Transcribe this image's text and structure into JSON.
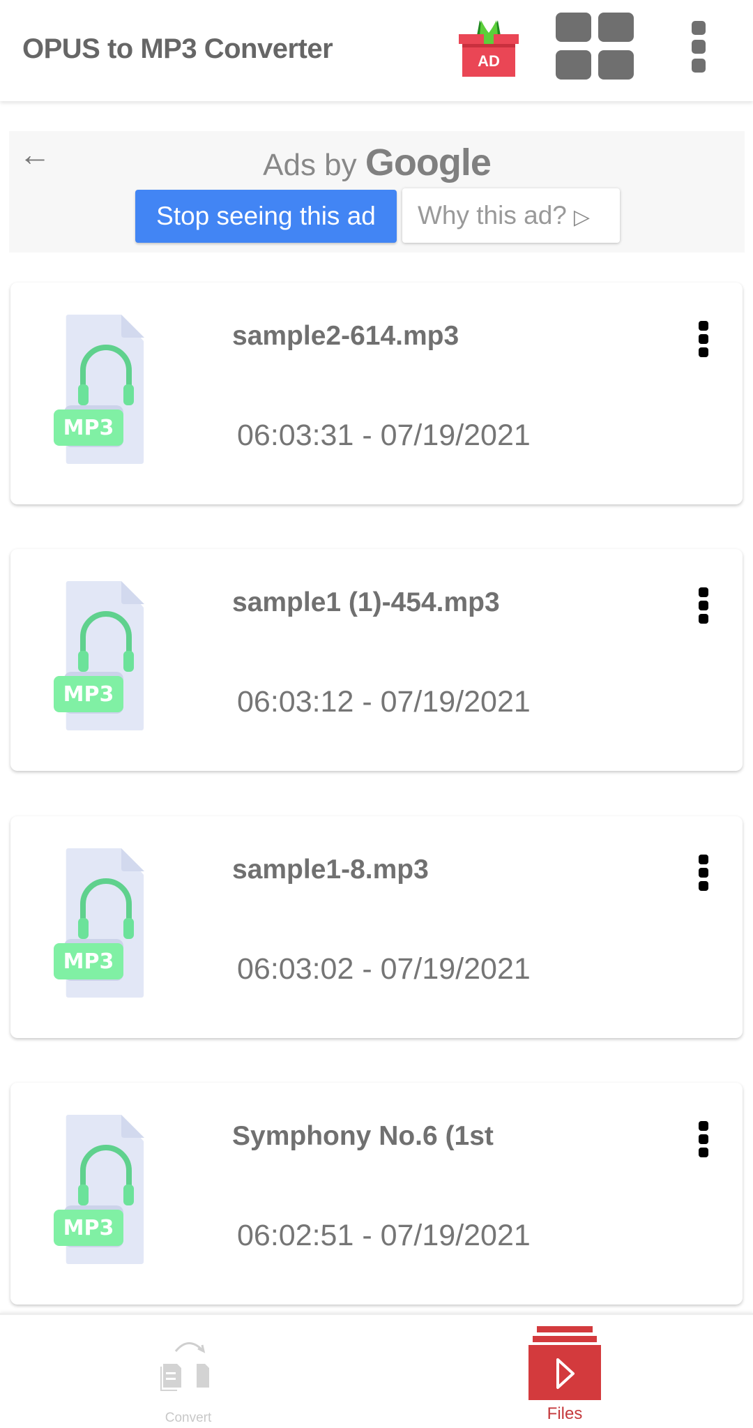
{
  "app_bar": {
    "title": "OPUS to MP3 Converter",
    "gift_badge": "AD",
    "icons": [
      "gift-ad-icon",
      "grid-view-icon",
      "more-vert-icon"
    ]
  },
  "ad": {
    "prefix": "Ads by ",
    "brand": "Google",
    "stop_label": "Stop seeing this ad",
    "why_label": "Why this ad?",
    "back_icon": "arrow-left-icon",
    "why_icon": "adchoices-icon",
    "accent": "#4285f4"
  },
  "files": [
    {
      "name": "sample2-614.mp3",
      "datetime": "06:03:31 - 07/19/2021",
      "badge": "MP3"
    },
    {
      "name": "sample1 (1)-454.mp3",
      "datetime": "06:03:12 - 07/19/2021",
      "badge": "MP3"
    },
    {
      "name": "sample1-8.mp3",
      "datetime": "06:03:02 - 07/19/2021",
      "badge": "MP3"
    },
    {
      "name": "Symphony No.6 (1st",
      "datetime": "06:02:51 - 07/19/2021",
      "badge": "MP3"
    }
  ],
  "bottom_nav": {
    "items": [
      {
        "label": "Convert",
        "icon": "convert-files-icon",
        "active": false
      },
      {
        "label": "Files",
        "icon": "files-play-icon",
        "active": true
      }
    ],
    "active_color": "#d33a3d",
    "inactive_color": "#c8c8c8"
  }
}
